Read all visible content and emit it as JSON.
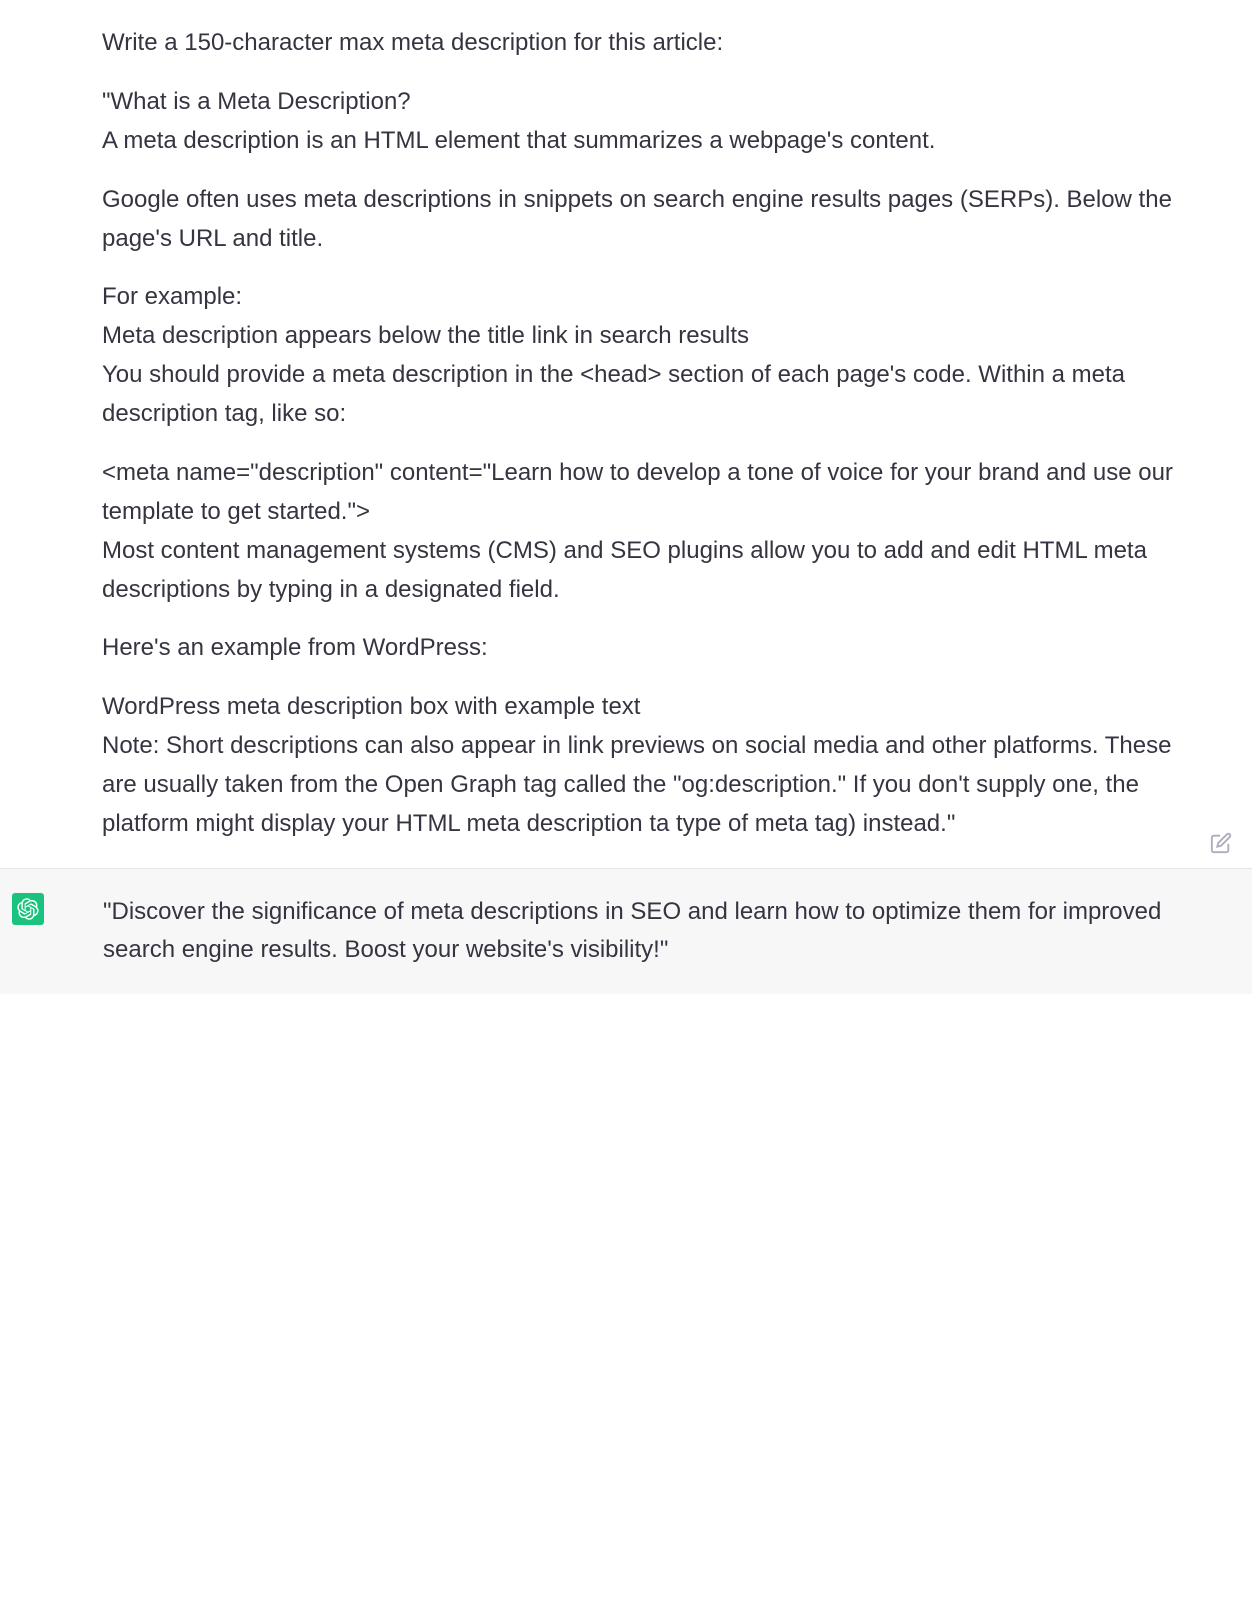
{
  "conversation": {
    "user": {
      "p1": "Write a 150-character max meta description for this article:",
      "p2": "\"What is a Meta Description?\nA meta description is an HTML element that summarizes a webpage's content.",
      "p3": "Google often uses meta descriptions in snippets on search engine results pages (SERPs). Below the page's URL and title.",
      "p4": "For example:\nMeta description appears below the title link in search results\nYou should provide a meta description in the <head> section of each page's code. Within a meta description tag, like so:",
      "p5": "<meta name=\"description\" content=\"Learn how to develop a tone of voice for your brand and use our template to get started.\">\nMost content management systems (CMS) and SEO plugins allow you to add and edit HTML meta descriptions by typing in a designated field.",
      "p6": "Here's an example from WordPress:",
      "p7": "WordPress meta description box with example text\nNote: Short descriptions can also appear in link previews on social media and other platforms. These are usually taken from the Open Graph tag called the \"og:description.\" If you don't supply one, the platform might display your HTML meta description ta type of meta tag) instead.\""
    },
    "assistant": {
      "response": "\"Discover the significance of meta descriptions in SEO and learn how to optimize them for improved search engine results. Boost your website's visibility!\""
    }
  },
  "icons": {
    "edit": "edit-icon",
    "assistant_logo": "chatgpt-logo"
  }
}
